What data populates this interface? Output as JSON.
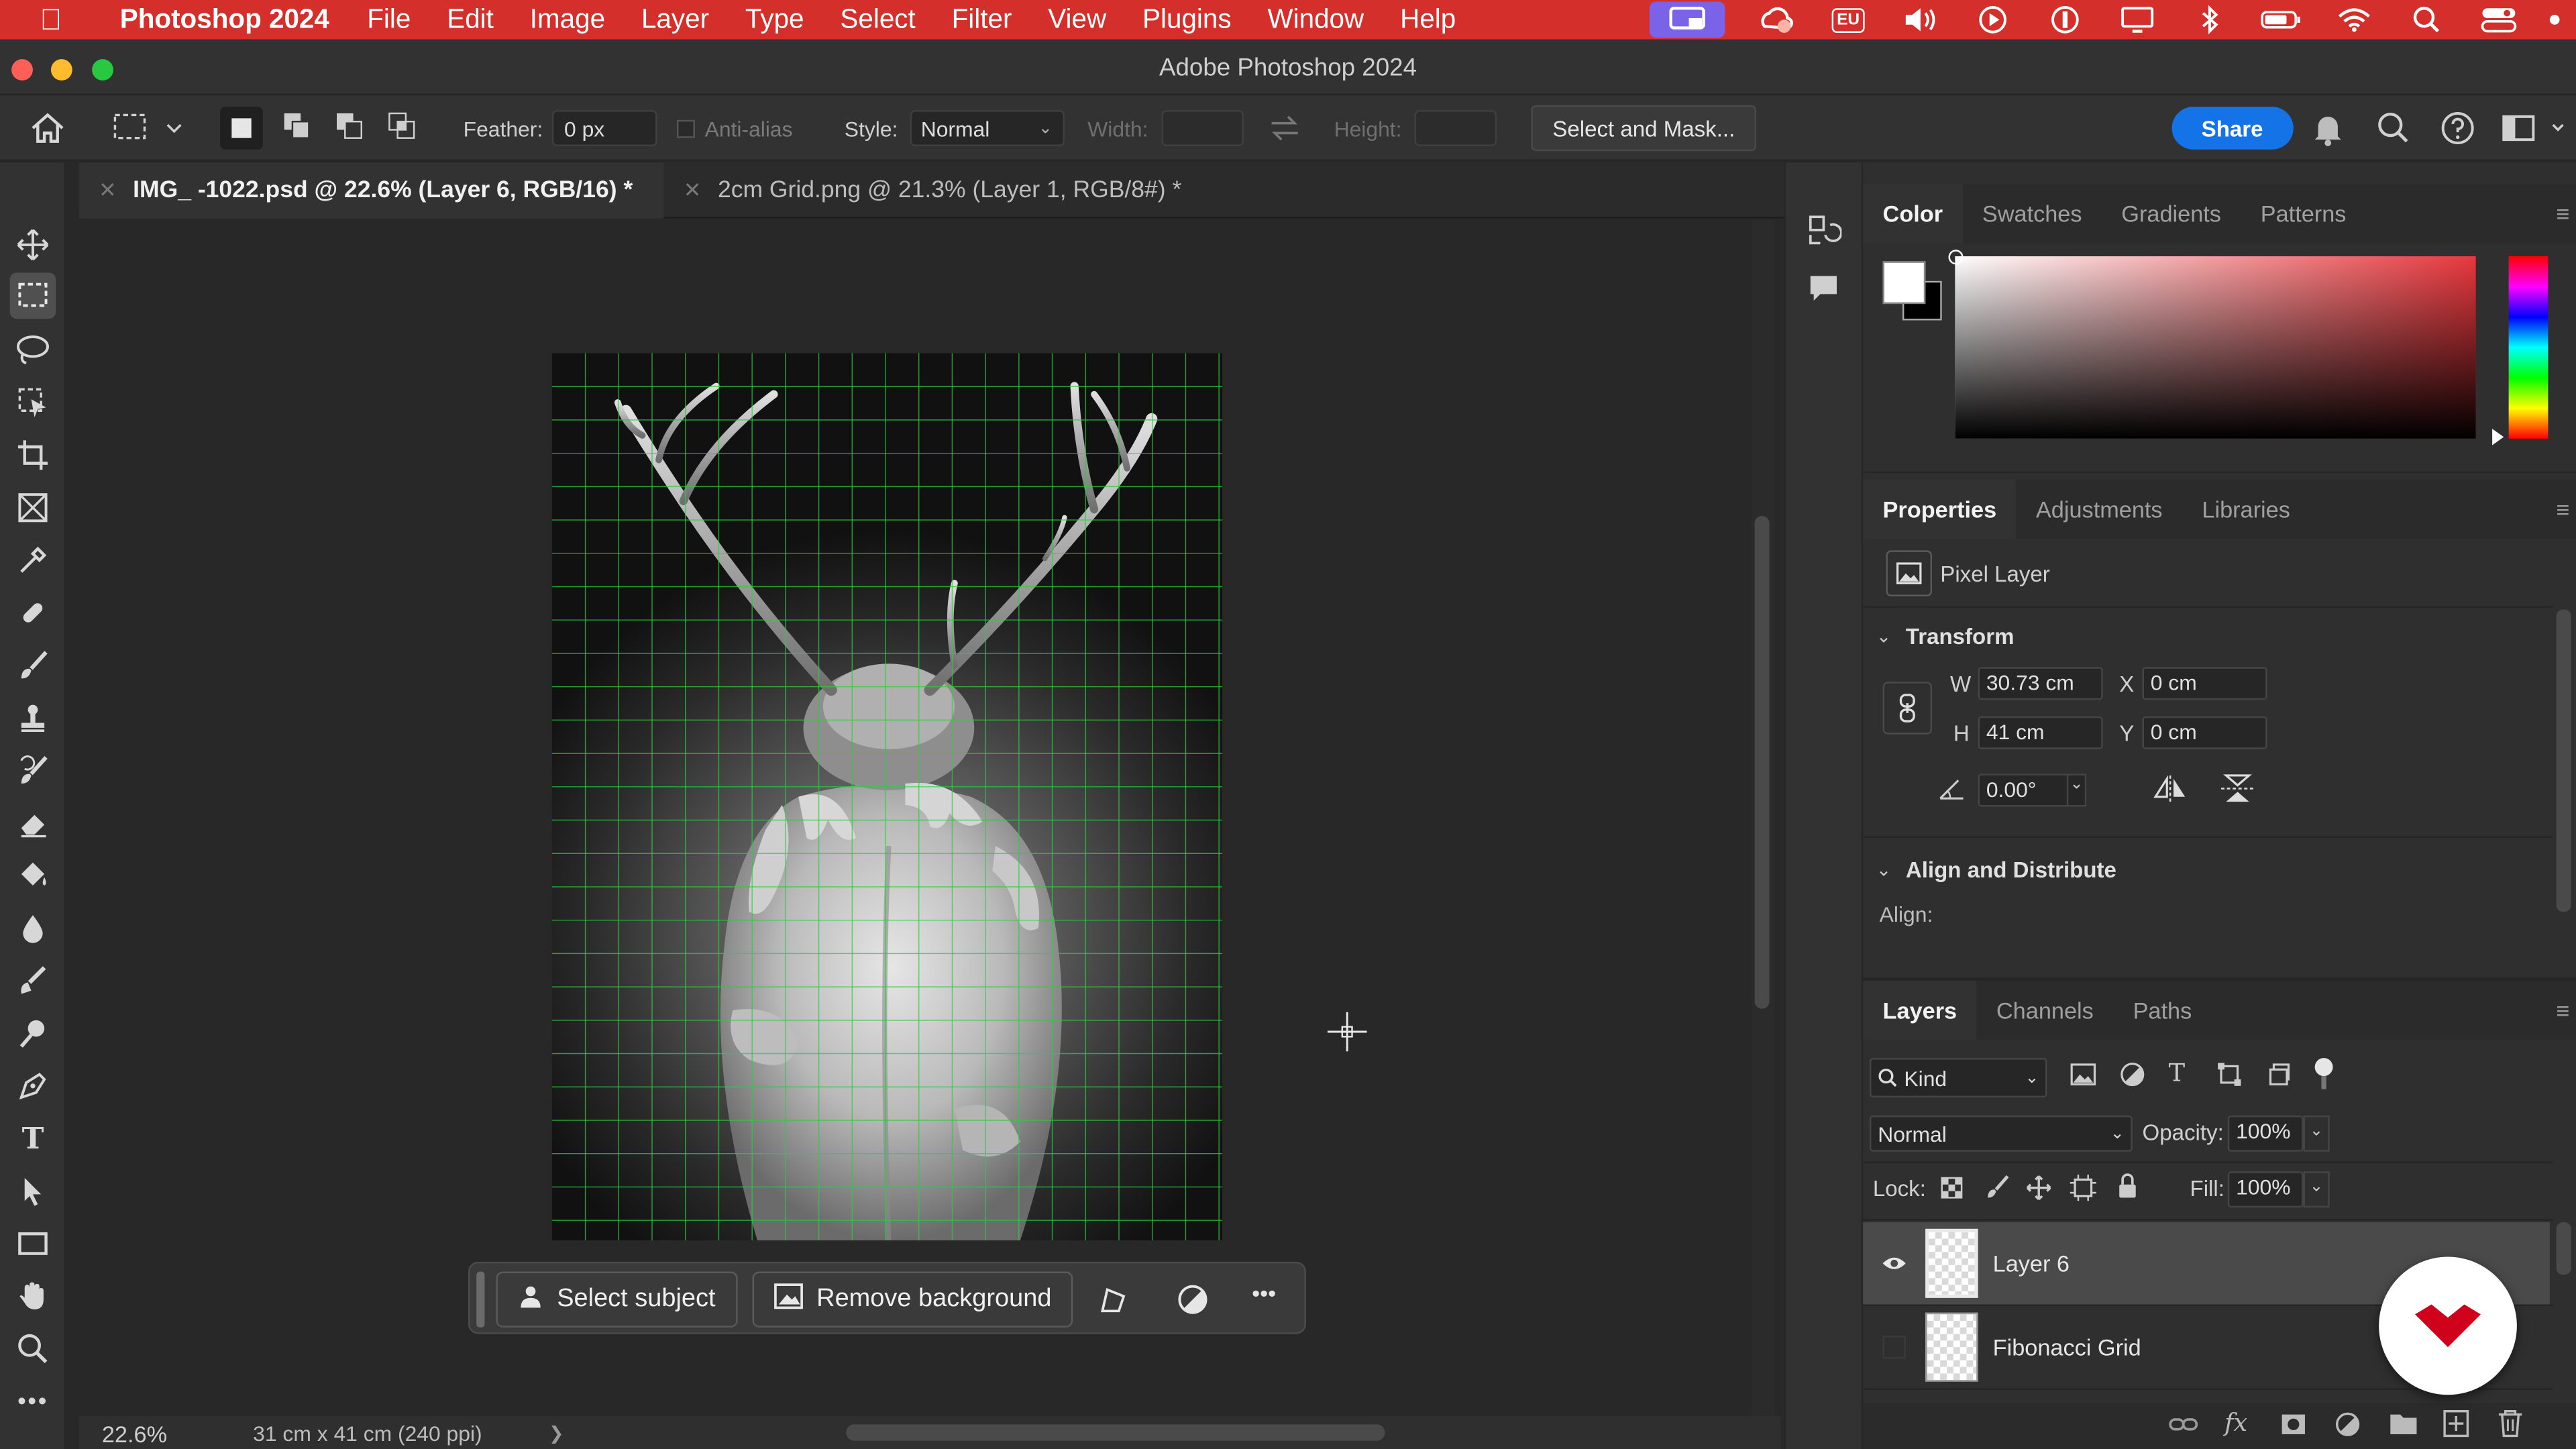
{
  "menubar": {
    "apple_icon": "apple-logo-icon",
    "app_name": "Photoshop 2024",
    "items": [
      "File",
      "Edit",
      "Image",
      "Layer",
      "Type",
      "Select",
      "Filter",
      "View",
      "Plugins",
      "Window",
      "Help"
    ],
    "status_icons": [
      "screen-mirroring-icon",
      "creative-cloud-icon",
      "eu-icon",
      "volume-icon",
      "play-icon",
      "dollar-icon",
      "display-icon",
      "bluetooth-icon",
      "battery-icon",
      "wifi-icon",
      "spotlight-search-icon",
      "control-center-icon"
    ],
    "status_eu_text": "EU"
  },
  "window": {
    "title": "Adobe Photoshop 2024"
  },
  "options_bar": {
    "feather_label": "Feather:",
    "feather_value": "0 px",
    "antialias_label": "Anti-alias",
    "style_label": "Style:",
    "style_value": "Normal",
    "width_label": "Width:",
    "height_label": "Height:",
    "select_mask_label": "Select and Mask...",
    "share_label": "Share"
  },
  "tabs": [
    {
      "label": "IMG_ -1022.psd @ 22.6% (Layer 6, RGB/16) *",
      "active": true
    },
    {
      "label": "2cm Grid.png @ 21.3% (Layer 1, RGB/8#) *",
      "active": false
    }
  ],
  "toolbar": {
    "tools": [
      "move-tool",
      "rectangular-marquee-tool",
      "lasso-tool",
      "object-selection-tool",
      "crop-tool",
      "frame-tool",
      "eyedropper-tool",
      "healing-brush-tool",
      "brush-tool",
      "clone-stamp-tool",
      "history-brush-tool",
      "eraser-tool",
      "paint-bucket-tool",
      "blur-tool",
      "smudge-tool",
      "dodge-tool",
      "pen-tool",
      "type-tool",
      "path-selection-tool",
      "rectangle-tool",
      "hand-tool",
      "zoom-tool",
      "more-tools"
    ],
    "selected": "rectangular-marquee-tool",
    "type_glyph": "T"
  },
  "context_bar": {
    "select_subject": "Select subject",
    "remove_background": "Remove background",
    "more": "•••"
  },
  "status": {
    "zoom": "22.6%",
    "doc_info": "31 cm x 41 cm (240 ppi)",
    "arrow": "❯"
  },
  "color_panel": {
    "tabs": [
      "Color",
      "Swatches",
      "Gradients",
      "Patterns"
    ],
    "active_tab": "Color",
    "foreground": "#ffffff",
    "background": "#000000",
    "hue_color": "#e8383d"
  },
  "properties_panel": {
    "tabs": [
      "Properties",
      "Adjustments",
      "Libraries"
    ],
    "active_tab": "Properties",
    "layer_type": "Pixel Layer",
    "transform_title": "Transform",
    "w_label": "W",
    "w_value": "30.73 cm",
    "h_label": "H",
    "h_value": "41 cm",
    "x_label": "X",
    "x_value": "0 cm",
    "y_label": "Y",
    "y_value": "0 cm",
    "angle_value": "0.00°",
    "align_title": "Align and Distribute",
    "align_label": "Align:"
  },
  "layers_panel": {
    "tabs": [
      "Layers",
      "Channels",
      "Paths"
    ],
    "active_tab": "Layers",
    "filter_value": "Kind",
    "blend_mode": "Normal",
    "opacity_label": "Opacity:",
    "opacity_value": "100%",
    "lock_label": "Lock:",
    "fill_label": "Fill:",
    "fill_value": "100%",
    "layers": [
      {
        "name": "Layer 6",
        "visible": true,
        "selected": true
      },
      {
        "name": "Fibonacci Grid",
        "visible": false,
        "selected": false
      }
    ],
    "fx_label": "fx"
  },
  "colors": {
    "menubar": "#d42f2b",
    "accent": "#1473e6",
    "grid": "#2ecc40",
    "heart_badge": "#d0021b"
  }
}
